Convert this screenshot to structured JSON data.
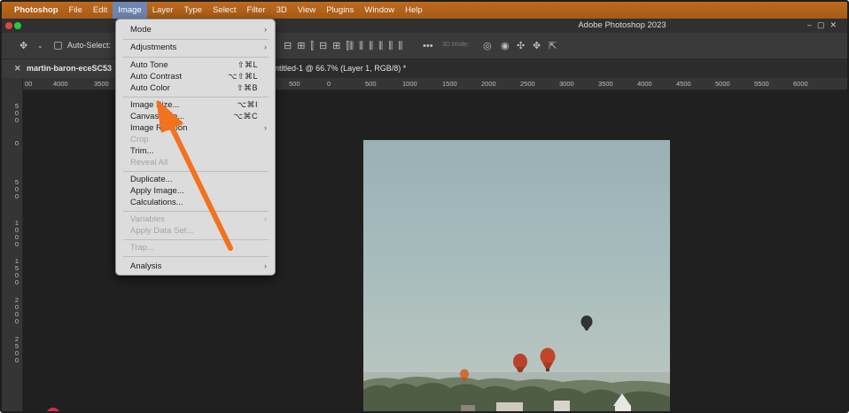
{
  "menubar": {
    "items": [
      "Photoshop",
      "File",
      "Edit",
      "Image",
      "Layer",
      "Type",
      "Select",
      "Filter",
      "3D",
      "View",
      "Plugins",
      "Window",
      "Help"
    ],
    "active_index": 3
  },
  "window": {
    "title": "Adobe Photoshop 2023"
  },
  "options_bar": {
    "auto_select_label": "Auto-Select:",
    "mode3d_label": "3D Mode:"
  },
  "tabs": {
    "first": "martin-baron-eceSC53",
    "second": "ntitled-1 @ 66.7% (Layer 1, RGB/8) *"
  },
  "ruler": {
    "h_ticks": [
      "00",
      "4000",
      "3500",
      "0",
      "500",
      "0",
      "500",
      "1000",
      "1500",
      "2000",
      "2500",
      "3000",
      "3500",
      "4000",
      "4500",
      "5000",
      "5500",
      "6000"
    ],
    "v_ticks": [
      "5\n0\n0",
      "0",
      "5\n0\n0",
      "1\n0\n0\n0",
      "1\n5\n0\n0",
      "2\n0\n0\n0",
      "2\n5\n0\n0"
    ]
  },
  "image_menu": {
    "items": [
      {
        "label": "Mode",
        "shortcut": "",
        "submenu": true,
        "disabled": false
      },
      {
        "label": "Adjustments",
        "shortcut": "",
        "submenu": true,
        "disabled": false
      },
      {
        "label": "Auto Tone",
        "shortcut": "⇧⌘L",
        "submenu": false,
        "disabled": false
      },
      {
        "label": "Auto Contrast",
        "shortcut": "⌥⇧⌘L",
        "submenu": false,
        "disabled": false
      },
      {
        "label": "Auto Color",
        "shortcut": "⇧⌘B",
        "submenu": false,
        "disabled": false
      },
      {
        "label": "Image Size...",
        "shortcut": "⌥⌘I",
        "submenu": false,
        "disabled": false
      },
      {
        "label": "Canvas Size...",
        "shortcut": "⌥⌘C",
        "submenu": false,
        "disabled": false
      },
      {
        "label": "Image Rotation",
        "shortcut": "",
        "submenu": true,
        "disabled": false
      },
      {
        "label": "Crop",
        "shortcut": "",
        "submenu": false,
        "disabled": true
      },
      {
        "label": "Trim...",
        "shortcut": "",
        "submenu": false,
        "disabled": false
      },
      {
        "label": "Reveal All",
        "shortcut": "",
        "submenu": false,
        "disabled": true
      },
      {
        "label": "Duplicate...",
        "shortcut": "",
        "submenu": false,
        "disabled": false
      },
      {
        "label": "Apply Image...",
        "shortcut": "",
        "submenu": false,
        "disabled": false
      },
      {
        "label": "Calculations...",
        "shortcut": "",
        "submenu": false,
        "disabled": false
      },
      {
        "label": "Variables",
        "shortcut": "",
        "submenu": true,
        "disabled": true
      },
      {
        "label": "Apply Data Set...",
        "shortcut": "",
        "submenu": false,
        "disabled": true
      },
      {
        "label": "Trap...",
        "shortcut": "",
        "submenu": false,
        "disabled": true
      },
      {
        "label": "Analysis",
        "shortcut": "",
        "submenu": true,
        "disabled": false
      }
    ]
  },
  "colors": {
    "menubar": "#b0611a",
    "active_menu": "#6e86b0",
    "annotation_arrow": "#f2721f",
    "balloon_red": "#c2452a"
  },
  "icons": [
    "move-tool-icon",
    "chevron-down-icon",
    "align-icon",
    "distribute-icon",
    "more-icon",
    "3d-orbit-icon",
    "3d-roll-icon",
    "3d-pan-icon",
    "3d-slide-icon",
    "3d-scale-icon"
  ]
}
